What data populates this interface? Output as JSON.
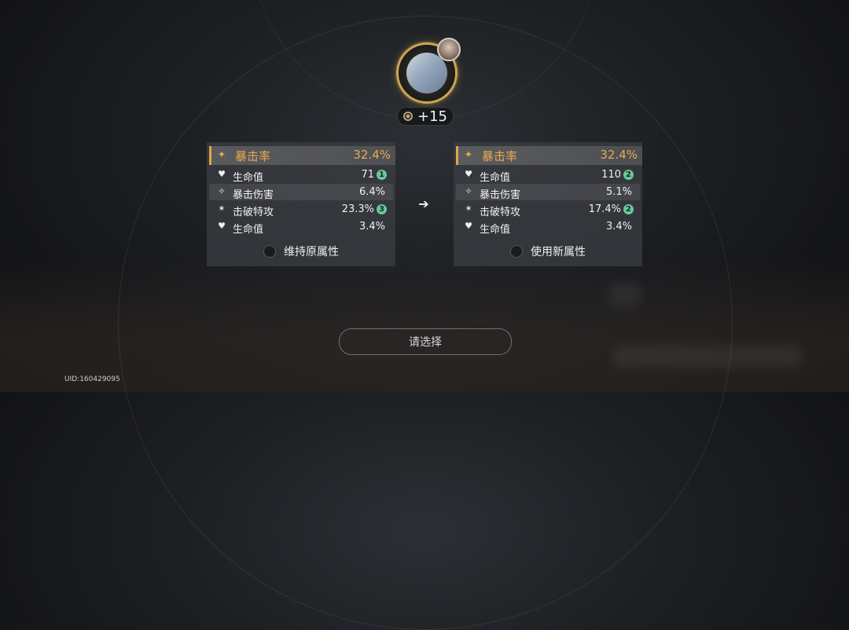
{
  "relic": {
    "level": "+15",
    "icon": "relic-body-armor-icon",
    "owner_icon": "character-avatar-icon"
  },
  "left_panel": {
    "main_stat": {
      "name": "暴击率",
      "value": "32.4%"
    },
    "sub_stats": [
      {
        "name": "生命值",
        "value": "71",
        "badge": "1"
      },
      {
        "name": "暴击伤害",
        "value": "6.4%",
        "badge": ""
      },
      {
        "name": "击破特攻",
        "value": "23.3%",
        "badge": "3"
      },
      {
        "name": "生命值",
        "value": "3.4%",
        "badge": ""
      }
    ],
    "choice_label": "维持原属性"
  },
  "right_panel": {
    "main_stat": {
      "name": "暴击率",
      "value": "32.4%"
    },
    "sub_stats": [
      {
        "name": "生命值",
        "value": "110",
        "badge": "2"
      },
      {
        "name": "暴击伤害",
        "value": "5.1%",
        "badge": ""
      },
      {
        "name": "击破特攻",
        "value": "17.4%",
        "badge": "2"
      },
      {
        "name": "生命值",
        "value": "3.4%",
        "badge": ""
      }
    ],
    "choice_label": "使用新属性"
  },
  "select_button": "请选择",
  "uid": "UID:160429095",
  "colors": {
    "accent_gold": "#e8a94e",
    "badge_green": "#67c99a"
  }
}
